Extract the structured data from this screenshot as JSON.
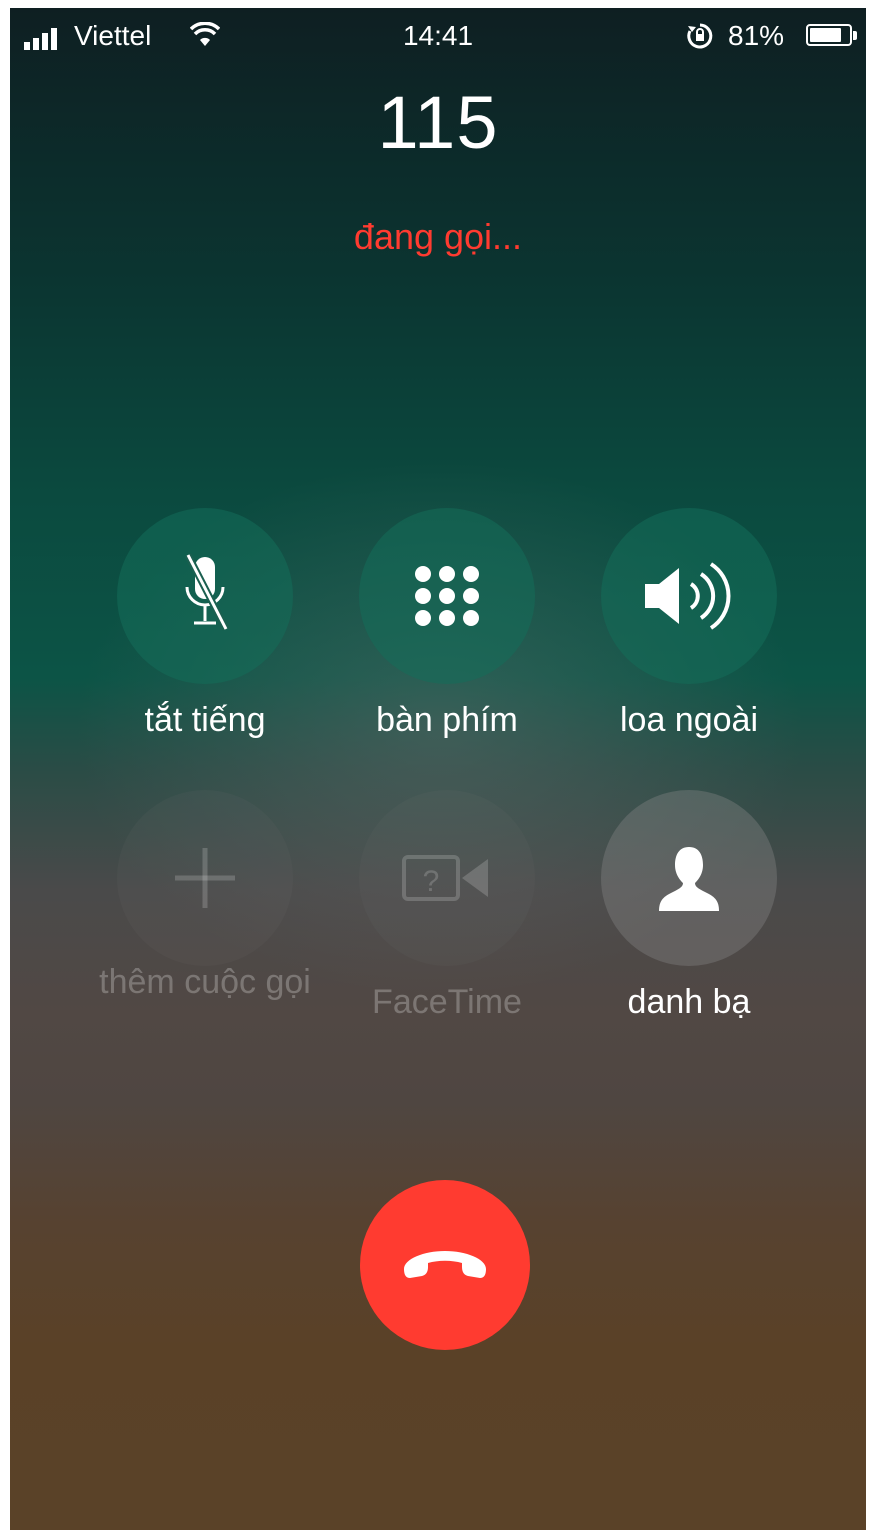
{
  "status_bar": {
    "carrier": "Viettel",
    "time": "14:41",
    "battery_percent": "81%",
    "battery_level": 0.81
  },
  "call": {
    "number": "115",
    "status": "đang gọi..."
  },
  "controls": {
    "mute_label": "tắt tiếng",
    "keypad_label": "bàn phím",
    "speaker_label": "loa ngoài",
    "add_call_label": "thêm cuộc gọi",
    "facetime_label": "FaceTime",
    "contacts_label": "danh bạ"
  },
  "icons": {
    "mute": "microphone-slash-icon",
    "keypad": "keypad-grid-icon",
    "speaker": "speaker-volume-icon",
    "add_call": "plus-icon",
    "facetime": "video-camera-question-icon",
    "contacts": "person-silhouette-icon",
    "end_call": "phone-hangup-icon"
  },
  "colors": {
    "end_call": "#ff3b30",
    "call_status": "#ff3b30"
  }
}
